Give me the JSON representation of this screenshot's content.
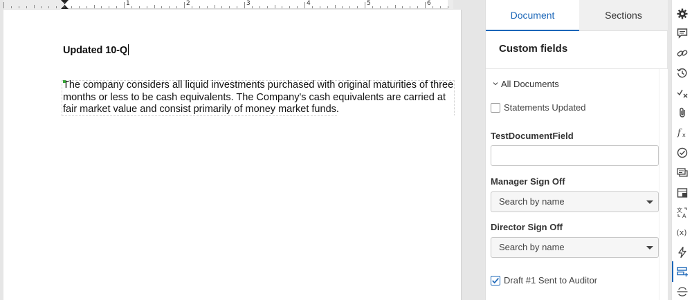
{
  "document": {
    "title": "Updated 10-Q",
    "paragraph": "The company considers all liquid investments purchased with original maturities of three months or less to be cash equivalents. The Company's cash equivalents are carried at fair market value and consist primarily of money market funds."
  },
  "ruler": {
    "numbers": [
      "1",
      "2",
      "3",
      "4",
      "5",
      "6"
    ]
  },
  "panel": {
    "tabs": {
      "document": "Document",
      "sections": "Sections"
    },
    "heading": "Custom fields",
    "group": "All Documents",
    "statements_updated": {
      "label": "Statements Updated",
      "checked": false
    },
    "test_field": {
      "label": "TestDocumentField",
      "value": ""
    },
    "manager": {
      "label": "Manager Sign Off",
      "placeholder": "Search by name"
    },
    "director": {
      "label": "Director Sign Off",
      "placeholder": "Search by name"
    },
    "draft": {
      "label": "Draft #1 Sent to Auditor",
      "checked": true
    }
  },
  "rail_icons": [
    "gear-icon",
    "comment-icon",
    "link-icon",
    "history-icon",
    "spellcheck-icon",
    "attachment-icon",
    "formula-icon",
    "check-circle-icon",
    "comments-stack-icon",
    "table-icon",
    "translate-icon",
    "variable-icon",
    "lightning-icon",
    "custom-fields-icon",
    "section-break-icon"
  ],
  "colors": {
    "accent": "#1a66b8",
    "paragraph_marker": "#3aa63a"
  }
}
